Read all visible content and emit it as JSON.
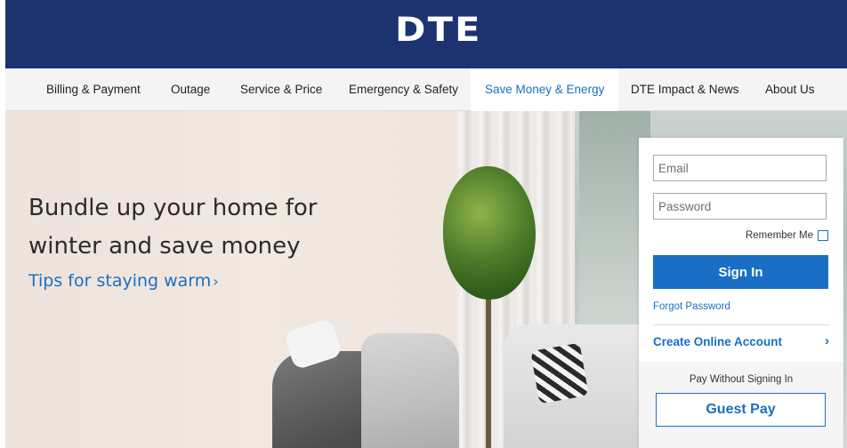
{
  "header": {
    "logo_text": "DTE"
  },
  "nav": {
    "items": [
      {
        "label": "Billing & Payment"
      },
      {
        "label": "Outage"
      },
      {
        "label": "Service & Price"
      },
      {
        "label": "Emergency & Safety"
      },
      {
        "label": "Save Money & Energy",
        "active": true
      },
      {
        "label": "DTE Impact & News"
      },
      {
        "label": "About Us"
      }
    ]
  },
  "hero": {
    "title": "Bundle up your home for winter and save money",
    "link_text": "Tips for staying warm",
    "link_chevron": "›"
  },
  "login": {
    "email_placeholder": "Email",
    "password_placeholder": "Password",
    "remember_label": "Remember Me",
    "signin_label": "Sign In",
    "forgot_label": "Forgot Password",
    "create_label": "Create Online Account",
    "create_chevron": "›",
    "pay_without_label": "Pay Without Signing In",
    "guest_pay_label": "Guest Pay"
  },
  "colors": {
    "header_bg": "#1c3370",
    "accent": "#1a6fc4",
    "nav_bg": "#f4f4f4"
  }
}
